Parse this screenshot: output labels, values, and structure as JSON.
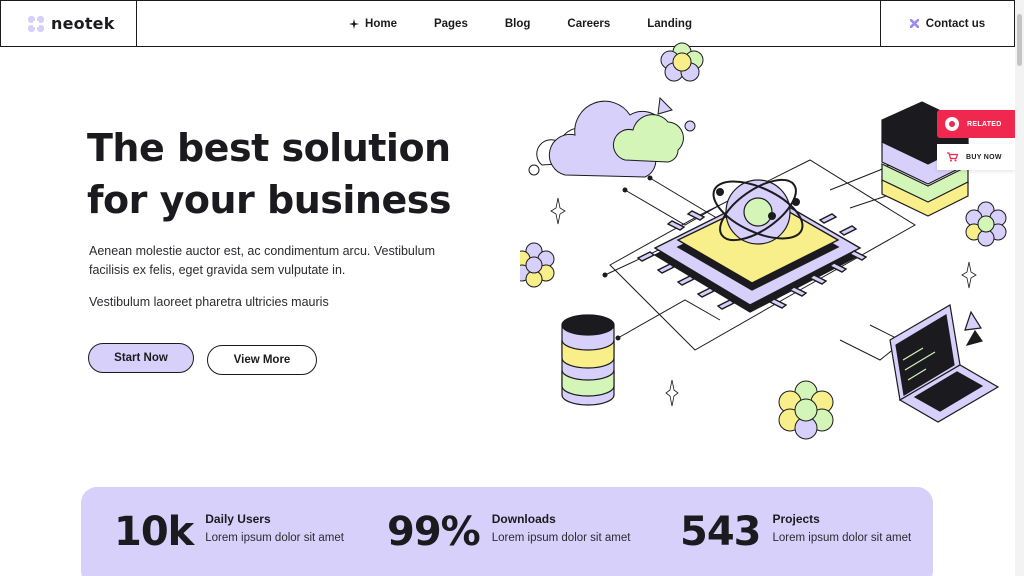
{
  "brand": {
    "name": "neotek"
  },
  "nav": {
    "items": [
      {
        "label": "Home",
        "icon": "sparkle-icon"
      },
      {
        "label": "Pages"
      },
      {
        "label": "Blog"
      },
      {
        "label": "Careers"
      },
      {
        "label": "Landing"
      }
    ],
    "contact_label": "Contact us"
  },
  "hero": {
    "title_line1": "The best solution",
    "title_line2": "for your business",
    "description": "Aenean molestie auctor est, ac condimentum arcu. Vestibulum facilisis ex felis, eget gravida sem vulputate in.",
    "subtext": "Vestibulum laoreet pharetra ultricies mauris",
    "primary_button": "Start Now",
    "secondary_button": "View More"
  },
  "widgets": {
    "related_label": "RELATED",
    "buy_label": "BUY NOW"
  },
  "stats": [
    {
      "value": "10k",
      "label": "Daily Users",
      "desc": "Lorem ipsum dolor sit amet"
    },
    {
      "value": "99%",
      "label": "Downloads",
      "desc": "Lorem ipsum dolor sit amet"
    },
    {
      "value": "543",
      "label": "Projects",
      "desc": "Lorem ipsum dolor sit amet"
    }
  ],
  "colors": {
    "accent_lavender": "#d7d0fa",
    "accent_yellow": "#f8ef8a",
    "accent_green": "#d3f5b8",
    "related_red": "#f0274e",
    "ink": "#1b1b1f"
  }
}
